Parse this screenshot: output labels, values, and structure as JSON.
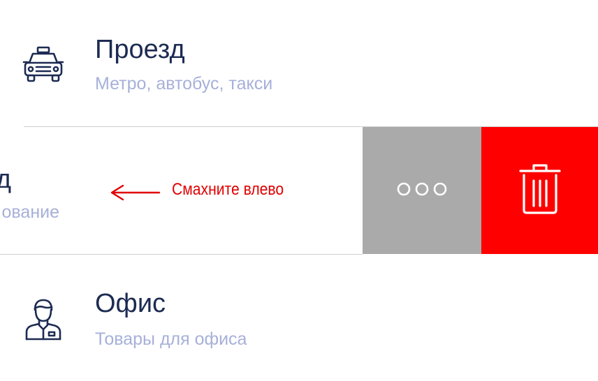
{
  "list": {
    "items": [
      {
        "title": "Проезд",
        "subtitle": "Метро, автобус, такси",
        "icon": "taxi-icon"
      },
      {
        "title_visible": "д",
        "subtitle_visible": "ование",
        "swipe_state": "revealed-actions"
      },
      {
        "title": "Офис",
        "subtitle": "Товары для офиса",
        "icon": "office-worker-icon"
      }
    ]
  },
  "swipe": {
    "hint_text": "Смахните влево",
    "hint_icon": "arrow-left-icon",
    "actions": [
      {
        "name": "more",
        "icon": "more-dots-icon",
        "color": "#aaaaaa"
      },
      {
        "name": "delete",
        "icon": "trash-icon",
        "color": "#ff0000"
      }
    ]
  },
  "colors": {
    "title": "#1c2b52",
    "subtitle": "#a7b0d9",
    "hint": "#e00000",
    "more_bg": "#aaaaaa",
    "delete_bg": "#ff0000"
  }
}
